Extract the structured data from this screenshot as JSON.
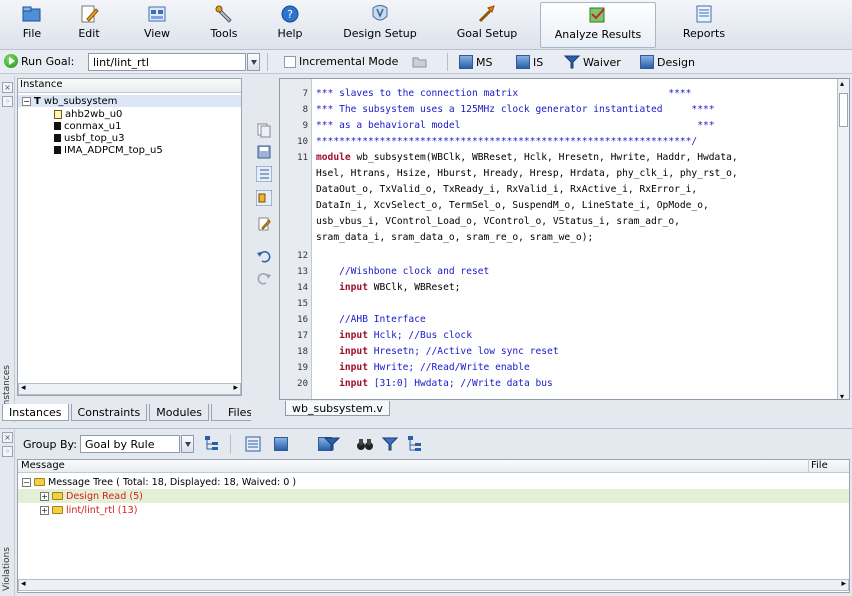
{
  "toolbar": {
    "file": "File",
    "edit": "Edit",
    "view": "View",
    "tools": "Tools",
    "help": "Help",
    "design_setup": "Design Setup",
    "goal_setup": "Goal Setup",
    "analyze_results": "Analyze Results",
    "reports": "Reports"
  },
  "goalbar": {
    "run_goal_label": "Run Goal:",
    "goal_value": "lint/lint_rtl",
    "incremental_mode": "Incremental Mode",
    "ms": "MS",
    "is": "IS",
    "waiver": "Waiver",
    "design": "Design"
  },
  "instances": {
    "header": "Instance",
    "root": "wb_subsystem",
    "children": [
      "ahb2wb_u0",
      "conmax_u1",
      "usbf_top_u3",
      "IMA_ADPCM_top_u5"
    ],
    "side_label": "Instances",
    "tabs": [
      "Instances",
      "Constraints",
      "Modules",
      "Files"
    ]
  },
  "editor": {
    "file_tab": "wb_subsystem.v",
    "line_numbers": [
      "7",
      "8",
      "9",
      "10",
      "11",
      "",
      "",
      "",
      "",
      "",
      "12",
      "13",
      "14",
      "15",
      "16",
      "17",
      "18",
      "19",
      "20"
    ],
    "lines": [
      "*** slaves to the connection matrix                          ****",
      "*** The subsystem uses a 125MHz clock generator instantiated     ****",
      "*** as a behavioral model                                         ***",
      "*****************************************************************/",
      "wb_subsystem(WBClk, WBReset, Hclk, Hresetn, Hwrite, Haddr, Hwdata,",
      "Hsel, Htrans, Hsize, Hburst, Hready, Hresp, Hrdata, phy_clk_i, phy_rst_o,",
      "DataOut_o, TxValid_o, TxReady_i, RxValid_i, RxActive_i, RxError_i,",
      "DataIn_i, XcvSelect_o, TermSel_o, SuspendM_o, LineState_i, OpMode_o,",
      "usb_vbus_i, VControl_Load_o, VControl_o, VStatus_i, sram_adr_o,",
      "sram_data_i, sram_data_o, sram_re_o, sram_we_o);",
      "",
      "    //Wishbone clock and reset",
      " WBClk, WBReset;",
      "",
      "    //AHB Interface",
      " Hclk; //Bus clock",
      " Hresetn; //Active low sync reset",
      " Hwrite; //Read/Write enable",
      " [31:0] Hwdata; //Write data bus"
    ],
    "keyword_module": "module",
    "keyword_input": "input"
  },
  "violations": {
    "group_by_label": "Group By:",
    "group_by_value": "Goal by Rule",
    "col_message": "Message",
    "col_file": "File",
    "tree_root": "Message Tree ( Total: 18, Displayed: 18, Waived: 0 )",
    "items": [
      {
        "label": "Design Read (5)"
      },
      {
        "label": "lint/lint_rtl (13)"
      }
    ],
    "side_label": "Violations"
  }
}
